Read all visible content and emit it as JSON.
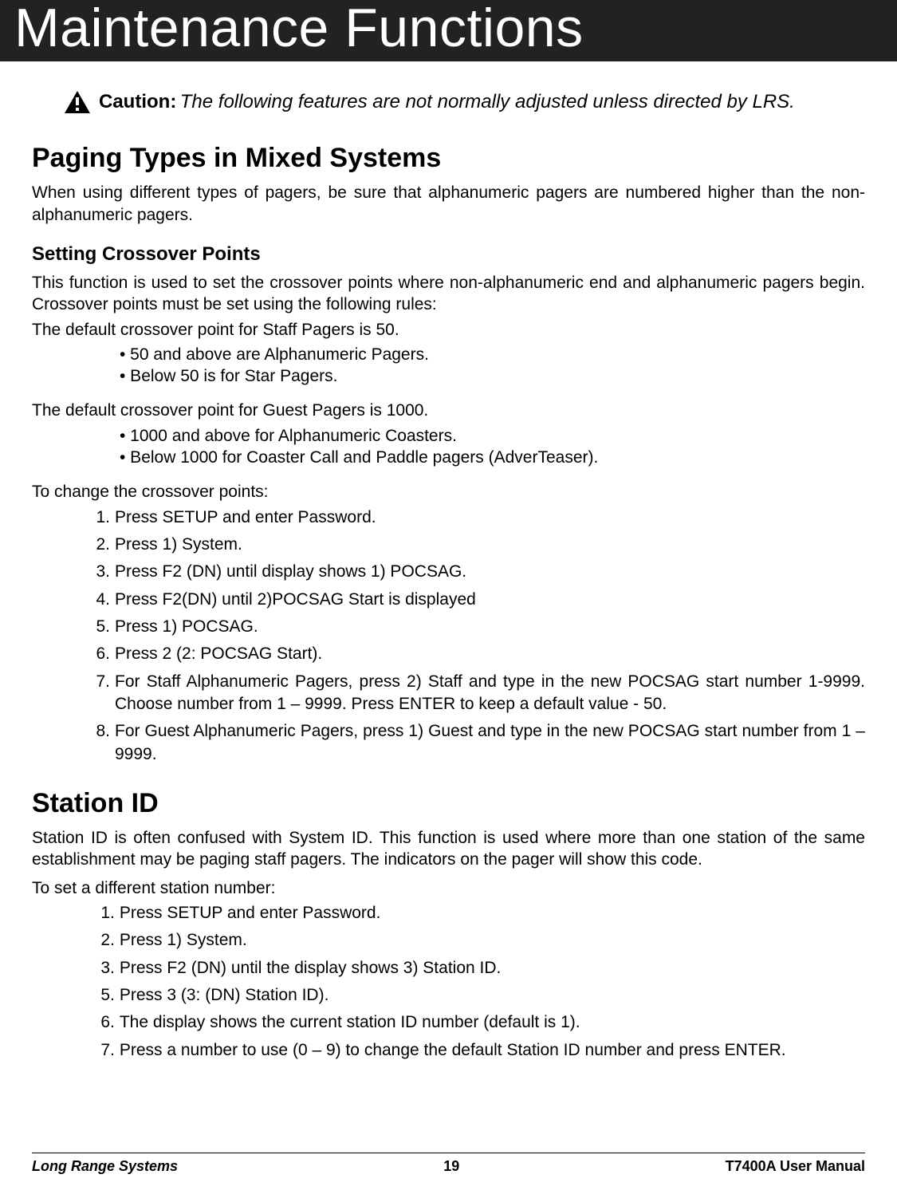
{
  "header": {
    "title": "Maintenance Functions"
  },
  "caution": {
    "label": "Caution:",
    "text": "The following features are not normally adjusted unless directed by LRS."
  },
  "section1": {
    "title": "Paging Types in Mixed Systems",
    "intro": "When using different types of pagers, be sure that alphanumeric pagers are numbered higher than the non-alphanumeric pagers.",
    "sub1": {
      "title": "Setting Crossover Points",
      "p1": "This function is used to set the crossover points where non-alphanumeric end and alphanumeric pagers begin. Crossover points must be set using the following rules:",
      "p2": "The default crossover point for Staff Pagers is 50.",
      "b1": "• 50 and above are Alphanumeric Pagers.",
      "b2": "• Below 50 is for Star Pagers.",
      "p3": "The default crossover point for Guest Pagers is 1000.",
      "b3": "• 1000 and above for Alphanumeric Coasters.",
      "b4": "• Below 1000 for Coaster Call and Paddle pagers (AdverTeaser).",
      "p4": "To change the crossover points:",
      "steps": [
        "Press SETUP and enter Password.",
        "Press 1) System.",
        "Press F2 (DN) until display shows 1) POCSAG.",
        "Press F2(DN) until 2)POCSAG Start is displayed",
        "Press 1) POCSAG.",
        "Press 2 (2: POCSAG Start).",
        "For Staff Alphanumeric Pagers, press 2) Staff and type in the new POCSAG start number 1-9999. Choose number from 1 – 9999. Press ENTER to keep a default value - 50.",
        "For Guest Alphanumeric Pagers,  press 1) Guest and type in the new POCSAG start number from 1 – 9999."
      ]
    }
  },
  "section2": {
    "title": "Station ID",
    "p1": "Station ID is often confused with System ID.  This function is used where more than one station of the same establishment may be paging staff pagers.  The indicators on the pager will show this code.",
    "p2": "To set a different station number:",
    "steps_nums": [
      "1",
      "2",
      "3",
      "5",
      "6",
      "7"
    ],
    "steps": [
      "Press SETUP and enter Password.",
      "Press 1) System.",
      "Press F2 (DN) until the display shows 3) Station ID.",
      "Press 3 (3: (DN) Station ID).",
      "The display shows the current station ID number (default is 1).",
      "Press a number to use (0 – 9) to change the default Station ID number and press ENTER."
    ]
  },
  "footer": {
    "left": "Long Range Systems",
    "center": "19",
    "right": "T7400A User Manual"
  }
}
